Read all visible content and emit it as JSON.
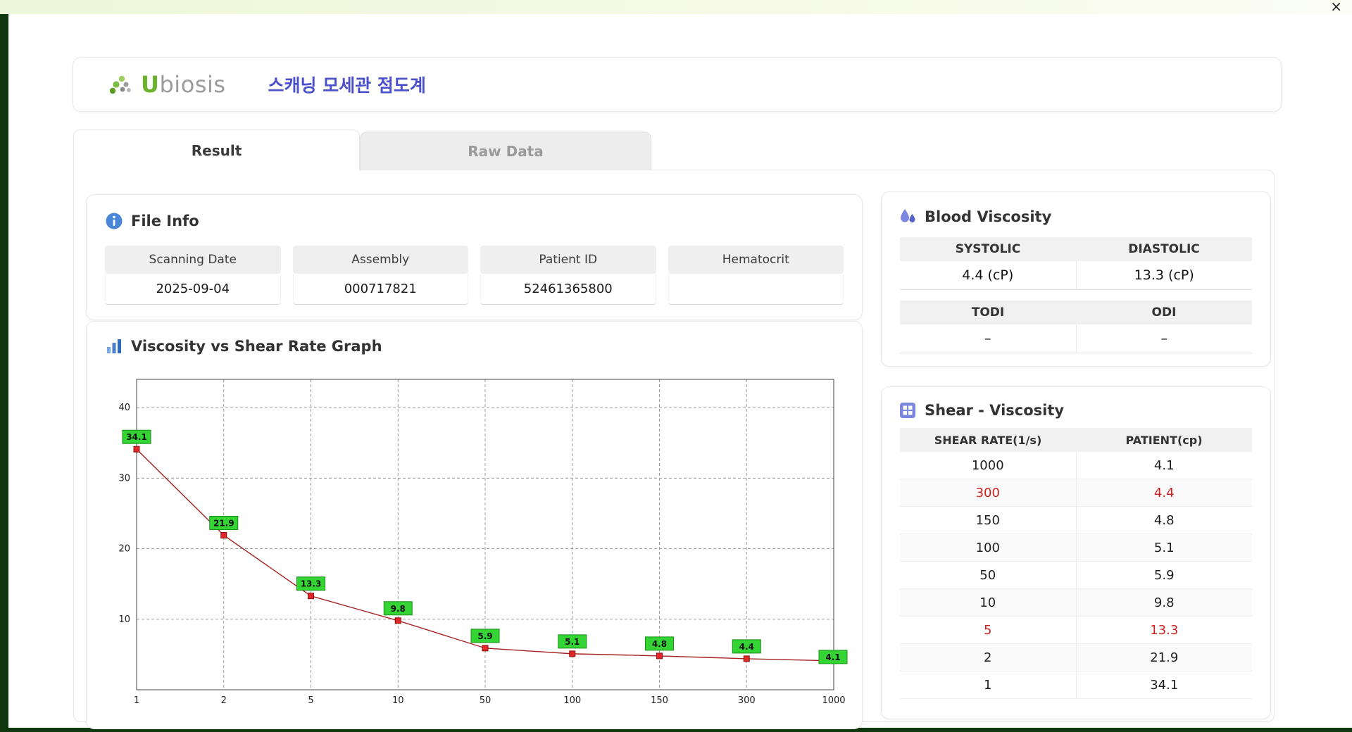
{
  "window": {
    "close_icon": "×"
  },
  "header": {
    "brand_u": "U",
    "brand_rest": "biosis",
    "title": "스캐닝 모세관 점도계"
  },
  "tabs": [
    {
      "label": "Result",
      "active": true
    },
    {
      "label": "Raw Data",
      "active": false
    }
  ],
  "file_info": {
    "title": "File Info",
    "fields": [
      {
        "label": "Scanning Date",
        "value": "2025-09-04"
      },
      {
        "label": "Assembly",
        "value": "000717821"
      },
      {
        "label": "Patient ID",
        "value": "52461365800"
      },
      {
        "label": "Hematocrit",
        "value": ""
      }
    ]
  },
  "blood_viscosity": {
    "title": "Blood Viscosity",
    "rows": [
      {
        "labels": [
          "SYSTOLIC",
          "DIASTOLIC"
        ],
        "values": [
          "4.4 (cP)",
          "13.3 (cP)"
        ]
      },
      {
        "labels": [
          "TODI",
          "ODI"
        ],
        "values": [
          "–",
          "–"
        ]
      }
    ]
  },
  "graph": {
    "title": "Viscosity vs Shear Rate Graph"
  },
  "chart_data": {
    "type": "line",
    "title": "Viscosity vs Shear Rate Graph",
    "x": [
      1,
      2,
      5,
      10,
      50,
      100,
      150,
      300,
      1000
    ],
    "x_scale": "categorical",
    "values": [
      34.1,
      21.9,
      13.3,
      9.8,
      5.9,
      5.1,
      4.8,
      4.4,
      4.1
    ],
    "xlabel": "",
    "ylabel": "",
    "ylim": [
      0,
      44
    ],
    "yticks": [
      10,
      20,
      30,
      40
    ],
    "grid": "dashed",
    "legend": "none",
    "line_color": "#a62121",
    "marker_color": "#e02828",
    "label_bg": "#35d435"
  },
  "shear_table": {
    "title": "Shear - Viscosity",
    "columns": [
      "SHEAR RATE(1/s)",
      "PATIENT(cp)"
    ],
    "rows": [
      {
        "shear": "1000",
        "patient": "4.1",
        "highlight": false
      },
      {
        "shear": "300",
        "patient": "4.4",
        "highlight": true
      },
      {
        "shear": "150",
        "patient": "4.8",
        "highlight": false
      },
      {
        "shear": "100",
        "patient": "5.1",
        "highlight": false
      },
      {
        "shear": "50",
        "patient": "5.9",
        "highlight": false
      },
      {
        "shear": "10",
        "patient": "9.8",
        "highlight": false
      },
      {
        "shear": "5",
        "patient": "13.3",
        "highlight": true
      },
      {
        "shear": "2",
        "patient": "21.9",
        "highlight": false
      },
      {
        "shear": "1",
        "patient": "34.1",
        "highlight": false
      }
    ]
  }
}
